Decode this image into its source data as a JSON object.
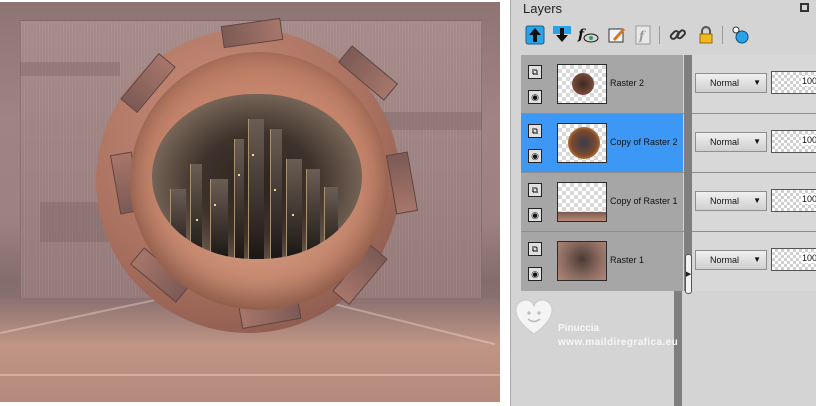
{
  "panel": {
    "title": "Layers"
  },
  "toolbar": {
    "tools": [
      {
        "name": "move-layer-up-icon"
      },
      {
        "name": "move-layer-down-icon"
      },
      {
        "name": "layer-effects-icon"
      },
      {
        "name": "edit-layer-icon"
      },
      {
        "name": "link-layer-icon"
      },
      {
        "name": "link-icon"
      },
      {
        "name": "lock-icon"
      },
      {
        "name": "layer-properties-icon"
      }
    ]
  },
  "layers": [
    {
      "label": "Raster 2",
      "blend_mode": "Normal",
      "opacity": "100",
      "selected": false
    },
    {
      "label": "Copy of Raster 2",
      "blend_mode": "Normal",
      "opacity": "100",
      "selected": true
    },
    {
      "label": "Copy of  Raster 1",
      "blend_mode": "Normal",
      "opacity": "100",
      "selected": false
    },
    {
      "label": "Raster 1",
      "blend_mode": "Normal",
      "opacity": "100",
      "selected": false
    }
  ],
  "watermark": {
    "line1": "Pinuccia",
    "line2": "www.maildiregrafica.eu"
  },
  "colors": {
    "selection": "#3c98f4",
    "panel_bg": "#d4d4d4"
  }
}
